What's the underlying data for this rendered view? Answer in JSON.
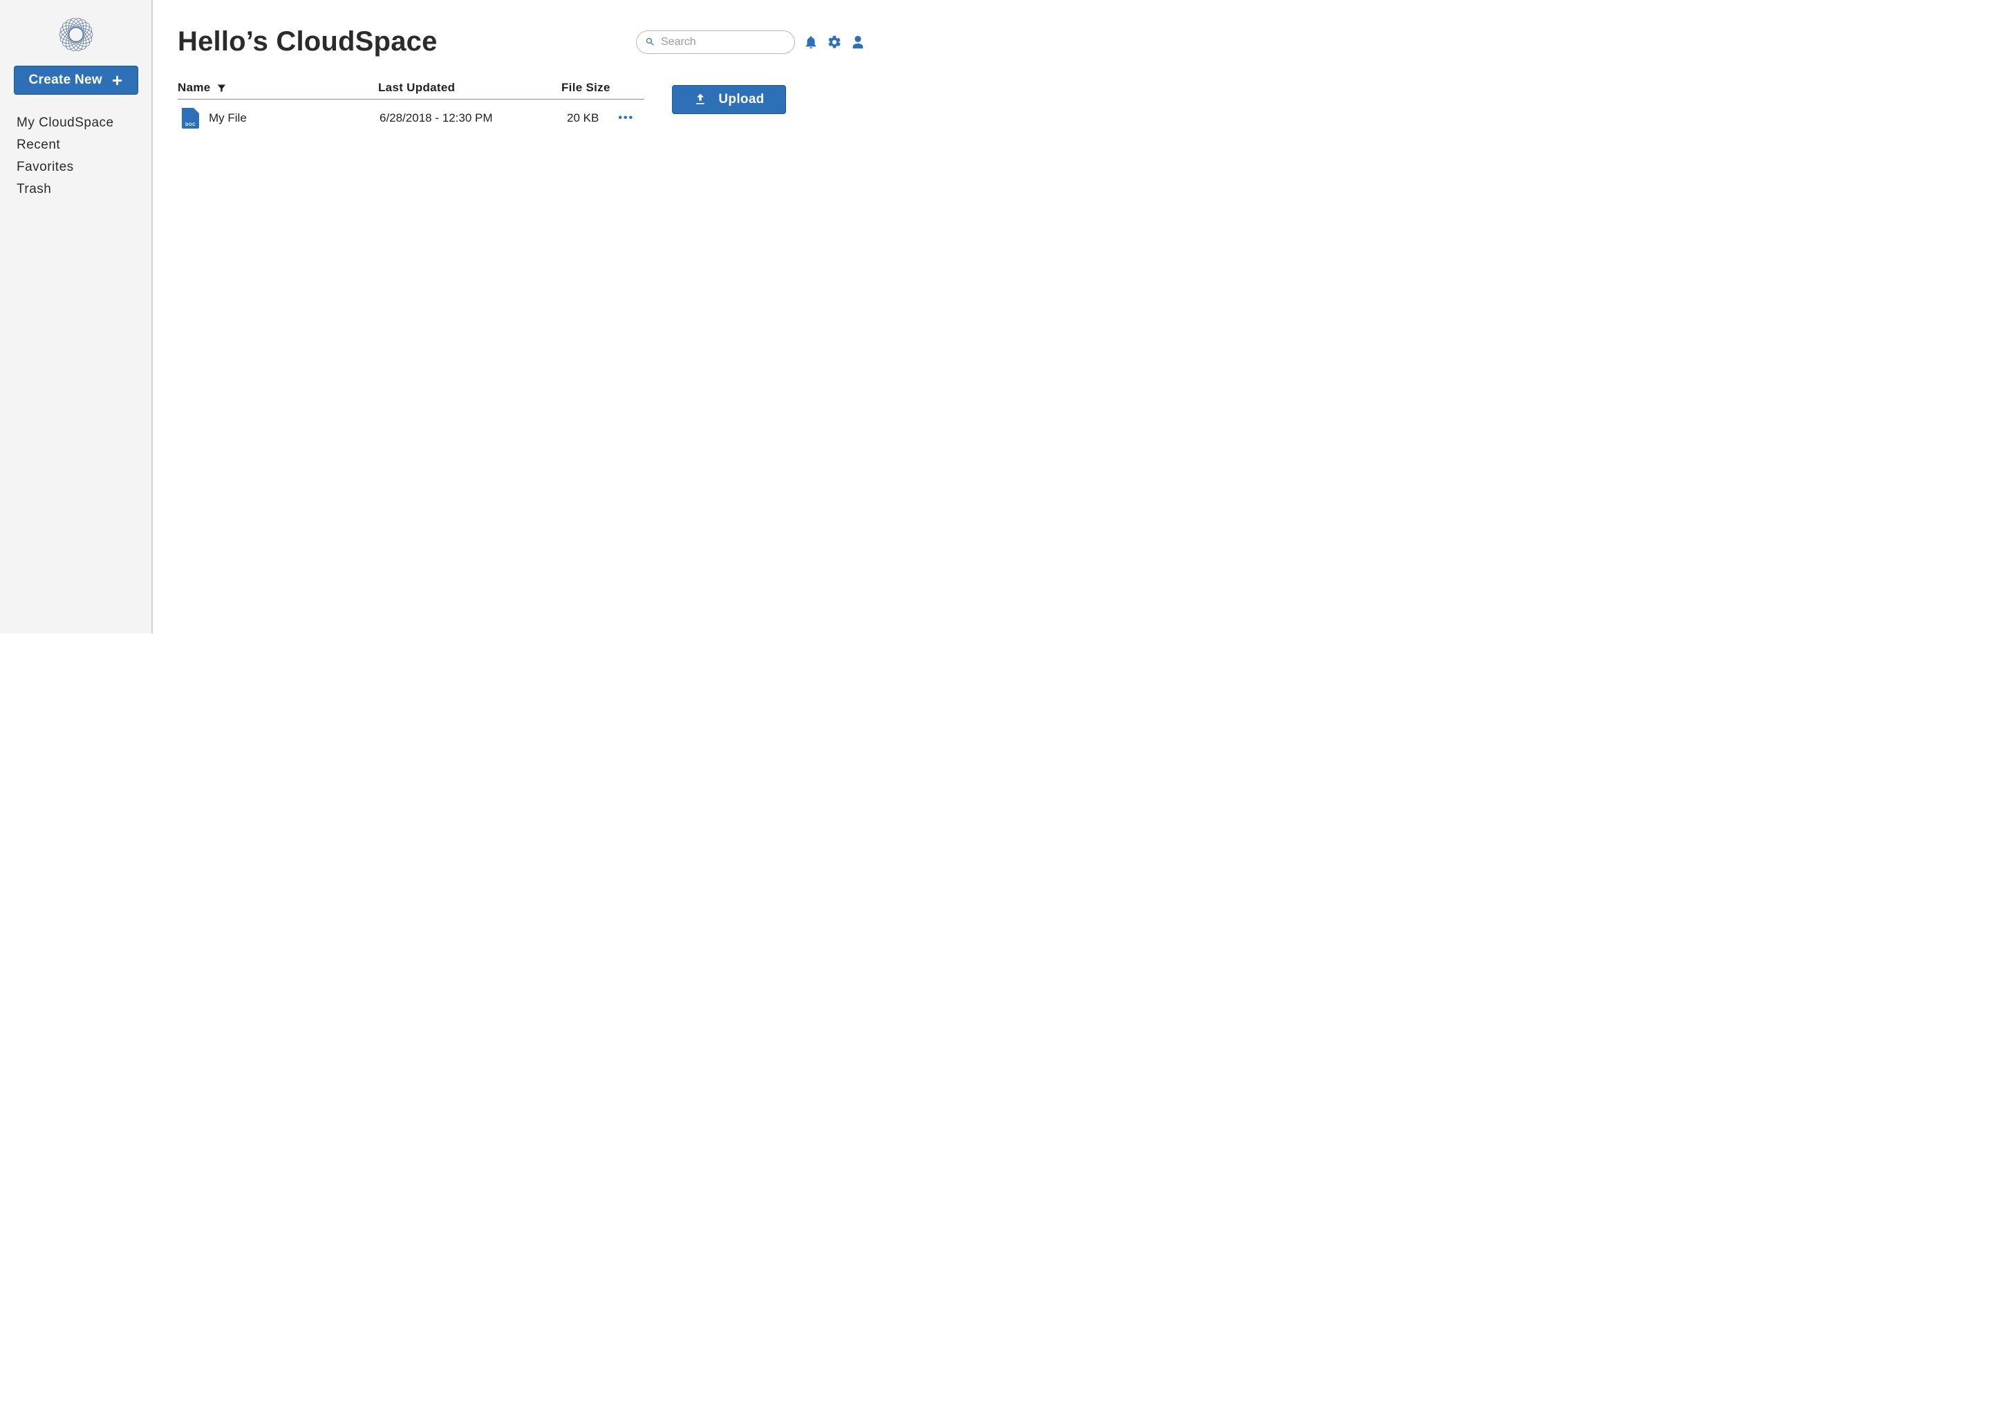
{
  "sidebar": {
    "create_label": "Create New",
    "items": [
      {
        "label": "My CloudSpace"
      },
      {
        "label": "Recent"
      },
      {
        "label": "Favorites"
      },
      {
        "label": "Trash"
      }
    ]
  },
  "header": {
    "title": "Hello’s CloudSpace",
    "search_placeholder": "Search"
  },
  "table": {
    "columns": {
      "name": "Name",
      "updated": "Last Updated",
      "size": "File Size"
    },
    "rows": [
      {
        "icon_type": "DOC",
        "name": "My File",
        "updated": "6/28/2018 - 12:30 PM",
        "size": "20 KB"
      }
    ]
  },
  "actions": {
    "upload_label": "Upload"
  },
  "colors": {
    "primary": "#2d70b8",
    "sidebar_bg": "#f4f4f5",
    "border": "#cfcfcf"
  }
}
